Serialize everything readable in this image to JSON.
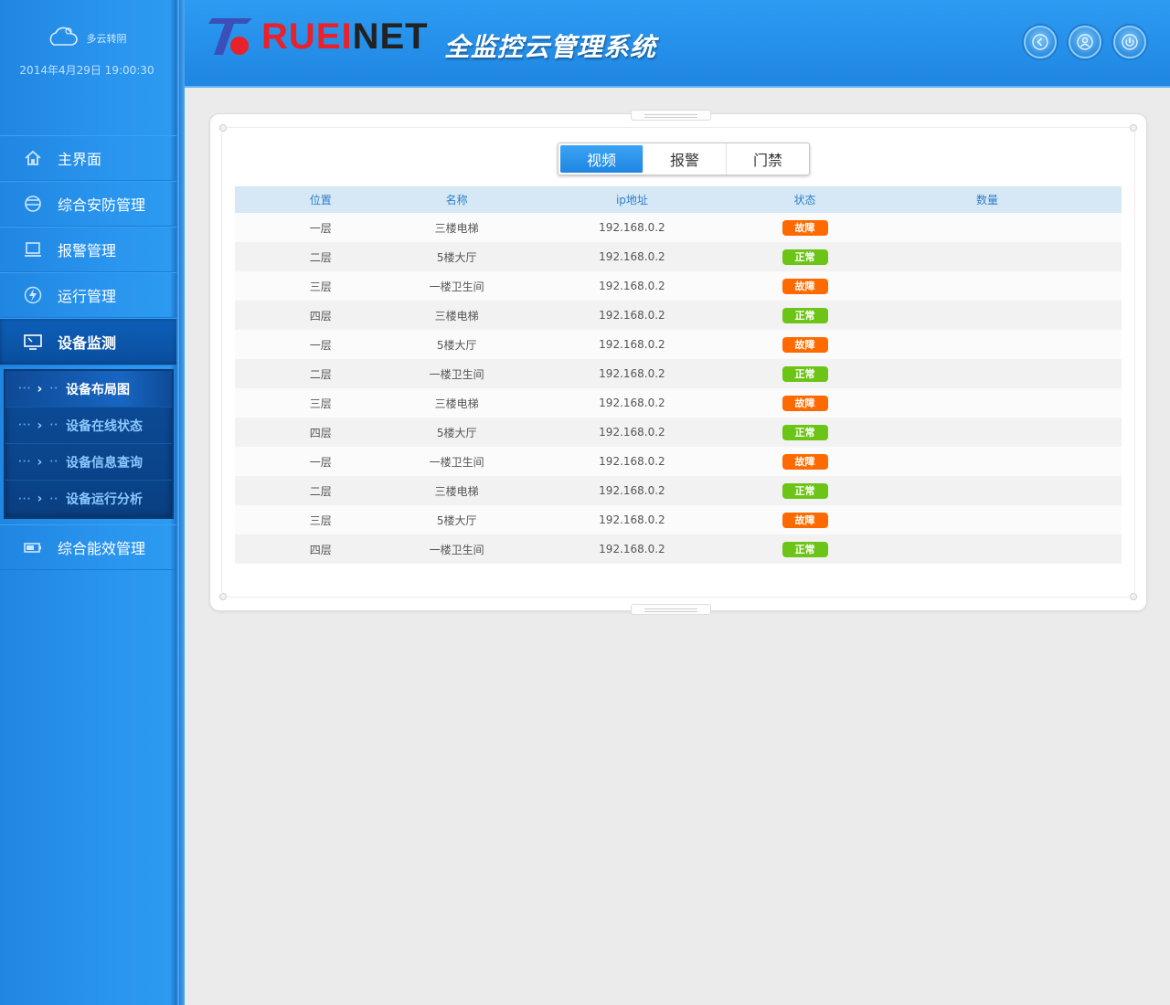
{
  "weather": {
    "text": "多云转阴",
    "icon": "cloud-icon"
  },
  "datetime": "2014年4月29日 19:00:30",
  "nav": {
    "items": [
      {
        "label": "主界面",
        "icon": "home-icon"
      },
      {
        "label": "综合安防管理",
        "icon": "helmet-icon"
      },
      {
        "label": "报警管理",
        "icon": "laptop-icon"
      },
      {
        "label": "运行管理",
        "icon": "lightning-icon"
      },
      {
        "label": "设备监测",
        "icon": "monitor-icon"
      }
    ],
    "submenu": [
      {
        "label": "设备布局图"
      },
      {
        "label": "设备在线状态"
      },
      {
        "label": "设备信息查询"
      },
      {
        "label": "设备运行分析"
      }
    ],
    "bottom_item": {
      "label": "综合能效管理",
      "icon": "battery-icon"
    }
  },
  "header": {
    "logo_red": "RUEI",
    "logo_dark": "NET",
    "title": "全监控云管理系统",
    "buttons": [
      {
        "name": "back",
        "icon": "back-icon"
      },
      {
        "name": "user",
        "icon": "user-icon"
      },
      {
        "name": "power",
        "icon": "power-icon"
      }
    ]
  },
  "tabs": [
    {
      "label": "视频"
    },
    {
      "label": "报警"
    },
    {
      "label": "门禁"
    }
  ],
  "table": {
    "columns": [
      "位置",
      "名称",
      "ip地址",
      "状态",
      "数量"
    ],
    "rows": [
      {
        "location": "一层",
        "name": "三楼电梯",
        "ip": "192.168.0.2",
        "status": "故障"
      },
      {
        "location": "二层",
        "name": "5楼大厅",
        "ip": "192.168.0.2",
        "status": "正常"
      },
      {
        "location": "三层",
        "name": "一楼卫生间",
        "ip": "192.168.0.2",
        "status": "故障"
      },
      {
        "location": "四层",
        "name": "三楼电梯",
        "ip": "192.168.0.2",
        "status": "正常"
      },
      {
        "location": "一层",
        "name": "5楼大厅",
        "ip": "192.168.0.2",
        "status": "故障"
      },
      {
        "location": "二层",
        "name": "一楼卫生间",
        "ip": "192.168.0.2",
        "status": "正常"
      },
      {
        "location": "三层",
        "name": "三楼电梯",
        "ip": "192.168.0.2",
        "status": "故障"
      },
      {
        "location": "四层",
        "name": "5楼大厅",
        "ip": "192.168.0.2",
        "status": "正常"
      },
      {
        "location": "一层",
        "name": "一楼卫生间",
        "ip": "192.168.0.2",
        "status": "故障"
      },
      {
        "location": "二层",
        "name": "三楼电梯",
        "ip": "192.168.0.2",
        "status": "正常"
      },
      {
        "location": "三层",
        "name": "5楼大厅",
        "ip": "192.168.0.2",
        "status": "故障"
      },
      {
        "location": "四层",
        "name": "一楼卫生间",
        "ip": "192.168.0.2",
        "status": "正常"
      }
    ]
  },
  "colors": {
    "fault": "#ff6a00",
    "normal": "#6cc417",
    "accent": "#2a93ec"
  }
}
